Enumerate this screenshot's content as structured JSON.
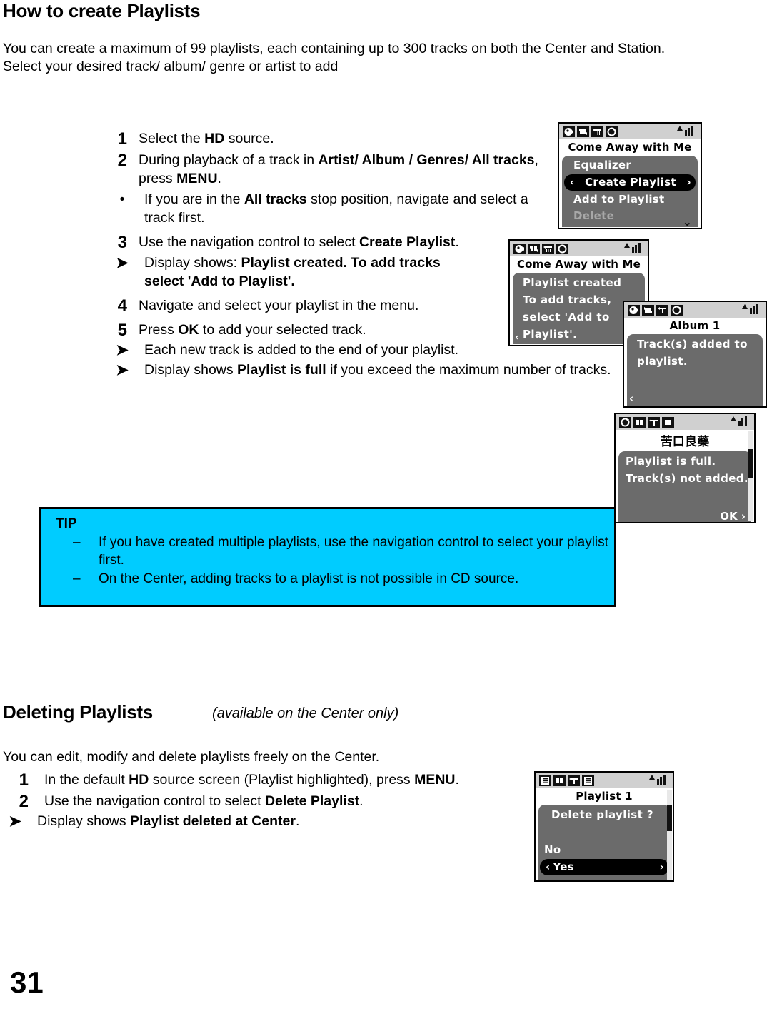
{
  "doc": {
    "page_number": "31"
  },
  "section1": {
    "title": "How to create Playlists",
    "intro": "You can create a maximum of 99 playlists, each containing up to 300 tracks on both the Center and Station. Select your desired track/ album/ genre or artist to add",
    "steps": [
      {
        "num": "1",
        "text_parts": [
          "Select the ",
          "HD",
          " source."
        ]
      },
      {
        "num": "2",
        "text_parts": [
          "During playback of a track in ",
          "Artist/ Album / Genres/ All tracks",
          ", press ",
          "MENU",
          "."
        ]
      },
      {
        "num": "3",
        "text_parts": [
          "Use the navigation control to select ",
          "Create Playlist",
          "."
        ]
      },
      {
        "num": "4",
        "text_parts": [
          "Navigate and select your playlist in the menu."
        ]
      },
      {
        "num": "5",
        "text_parts": [
          "Press ",
          "OK",
          " to add your selected track."
        ]
      }
    ],
    "bullet_after_2": {
      "marker": "bullet",
      "parts": [
        "If you are in the ",
        "All tracks",
        " stop position, navigate and select a track first."
      ]
    },
    "arrow_after_3": {
      "marker": "arrow",
      "parts": [
        "Display shows: ",
        "Playlist created. To add tracks select 'Add to Playlist'."
      ]
    },
    "arrows_after_5": [
      {
        "marker": "arrow",
        "parts": [
          "Each new track is added to the end of your playlist."
        ]
      },
      {
        "marker": "arrow",
        "parts": [
          "Display shows ",
          "Playlist is full",
          " if you exceed the maximum number of tracks."
        ]
      }
    ]
  },
  "tip": {
    "title": "TIP",
    "bg_color": "#00CCFF",
    "items": [
      "If you have created multiple playlists, use the navigation control to select your playlist first.",
      "On the Center, adding tracks to a playlist is not possible in CD source."
    ],
    "dash": "–"
  },
  "section2": {
    "title": "Deleting Playlists",
    "subtitle": "(available on the Center only)",
    "intro": "You can edit, modify and delete playlists freely on the Center.",
    "steps": [
      {
        "num": "1",
        "text_parts": [
          "In the default ",
          "HD",
          " source screen (Playlist highlighted), press ",
          "MENU",
          "."
        ]
      },
      {
        "num": "2",
        "text_parts": [
          "Use the navigation control to select ",
          "Delete Playlist",
          "."
        ]
      }
    ],
    "arrow": {
      "parts": [
        "Display shows ",
        "Playlist deleted at Center",
        "."
      ]
    }
  },
  "lcd_screens": [
    {
      "id": "lcd-create-playlist-menu",
      "icons": [
        "hd-source-icon",
        "shuffle-icon",
        "repeat-icon",
        "cd-disc-icon"
      ],
      "signal": "signal-bars-icon",
      "title": "Come Away with Me",
      "rows": [
        {
          "label": "Equalizer",
          "state": "normal"
        },
        {
          "label": "Create Playlist",
          "state": "selected",
          "left_caret": "‹",
          "right_caret": "›"
        },
        {
          "label": "Add to Playlist",
          "state": "normal"
        },
        {
          "label": "Delete",
          "state": "dim"
        }
      ],
      "down_chevron": "⌄"
    },
    {
      "id": "lcd-playlist-created",
      "icons": [
        "hd-source-icon",
        "shuffle-icon",
        "repeat-icon",
        "cd-disc-icon"
      ],
      "signal": "signal-bars-icon",
      "title": "Come Away with Me",
      "messages": [
        "Playlist  created",
        "To add tracks,",
        "select 'Add to",
        "Playlist'."
      ],
      "left_caret": "‹"
    },
    {
      "id": "lcd-tracks-added",
      "icons": [
        "hd-source-icon",
        "shuffle-icon",
        "repeat-up-icon",
        "cd-disc-icon"
      ],
      "signal": "signal-bars-icon",
      "title": "Album 1",
      "messages": [
        "Track(s) added to",
        "playlist."
      ],
      "left_caret": "‹"
    },
    {
      "id": "lcd-playlist-full",
      "icons": [
        "cd-disc-icon",
        "shuffle-icon",
        "repeat-up-icon",
        "stop-icon"
      ],
      "signal": "signal-bars-icon",
      "title": "苦口良藥",
      "messages": [
        "Playlist is full.",
        "Track(s) not added."
      ],
      "ok_label": "OK ›"
    },
    {
      "id": "lcd-delete-playlist",
      "icons": [
        "list-icon",
        "shuffle-icon",
        "repeat-up-icon",
        "list-icon"
      ],
      "signal": "signal-bars-icon",
      "title": "Playlist 1",
      "messages": [
        "Delete playlist ?"
      ],
      "options": [
        {
          "label": "No",
          "state": "normal"
        },
        {
          "label": "Yes",
          "state": "selected",
          "left_caret": "‹",
          "right_caret": "›"
        }
      ]
    }
  ]
}
